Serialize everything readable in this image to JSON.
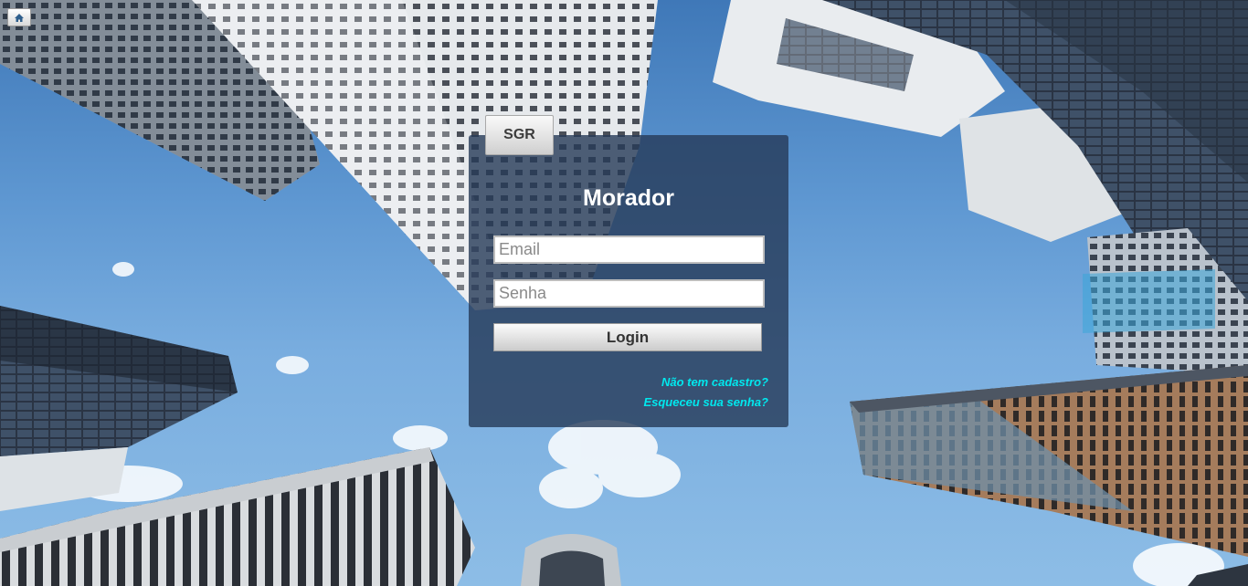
{
  "header": {
    "home_icon": "home-icon"
  },
  "panel": {
    "tab_label": "SGR",
    "title": "Morador",
    "email_placeholder": "Email",
    "senha_placeholder": "Senha",
    "login_label": "Login",
    "register_link": "Não tem cadastro?",
    "forgot_link": "Esqueceu sua senha?"
  },
  "colors": {
    "panel_bg": "#263a58",
    "link": "#00e8ee",
    "sky": "#5f98d2"
  }
}
